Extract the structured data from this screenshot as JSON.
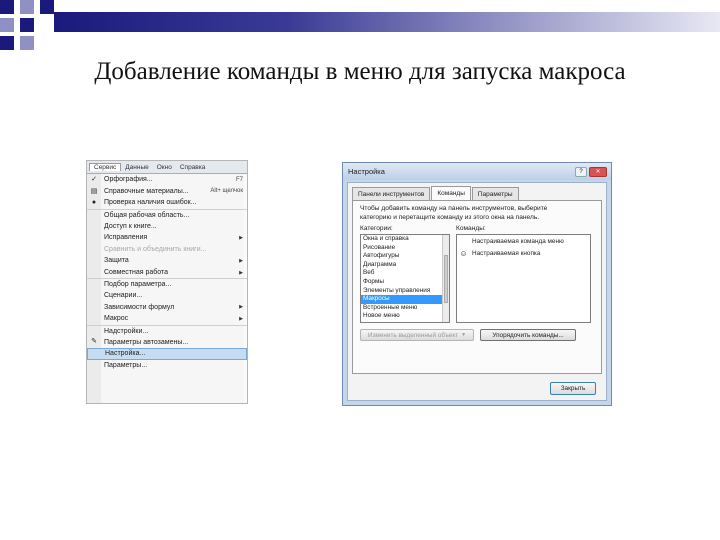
{
  "slide": {
    "title": "Добавление команды в меню для запуска макроса"
  },
  "colors": {
    "header_dark": "#1a1a7c",
    "header_light": "#e8e8f4",
    "highlight": "#c6dcf3",
    "selection": "#3399ff"
  },
  "menu": {
    "menubar": [
      "Сервис",
      "Данные",
      "Окно",
      "Справка"
    ],
    "items": [
      {
        "label": "Орфография...",
        "shortcut": "F7",
        "icon": "spelling-icon",
        "glyph": "✓"
      },
      {
        "label": "Справочные материалы...",
        "shortcut": "Alt+ щелчок",
        "icon": "book-icon",
        "glyph": "▤"
      },
      {
        "label": "Проверка наличия ошибок...",
        "icon": "error-check-icon",
        "glyph": "●"
      },
      {
        "label": "Общая рабочая область..."
      },
      {
        "label": "Доступ к книге..."
      },
      {
        "label": "Исправления",
        "submenu": true
      },
      {
        "label": "Сравнить и объединить книги...",
        "disabled": true
      },
      {
        "label": "Защита",
        "submenu": true
      },
      {
        "label": "Совместная работа",
        "submenu": true
      },
      {
        "label": "Подбор параметра..."
      },
      {
        "label": "Сценарии..."
      },
      {
        "label": "Зависимости формул",
        "submenu": true
      },
      {
        "label": "Макрос",
        "submenu": true
      },
      {
        "label": "Надстройки..."
      },
      {
        "label": "Параметры автозамены...",
        "icon": "autocorrect-icon",
        "glyph": "✎"
      },
      {
        "label": "Настройка...",
        "highlighted": true
      },
      {
        "label": "Параметры..."
      }
    ]
  },
  "dialog": {
    "title": "Настройка",
    "title_buttons": [
      "?",
      "✕"
    ],
    "tabs": [
      "Панели инструментов",
      "Команды",
      "Параметры"
    ],
    "active_tab": 1,
    "instruction": "Чтобы добавить команду на панель инструментов, выберите категорию и перетащите команду из этого окна на панель.",
    "categories_label": "Категории:",
    "commands_label": "Команды:",
    "categories": [
      "Окна и справка",
      "Рисование",
      "Автофигуры",
      "Диаграмма",
      "Веб",
      "Формы",
      "Элементы управления",
      "Макросы",
      "Встроенные меню",
      "Новое меню"
    ],
    "selected_category": 7,
    "commands": [
      {
        "label": "Настраиваемая команда меню",
        "icon": "custom-menu-command-icon",
        "glyph": "",
        "selected": true
      },
      {
        "label": "Настраиваемая кнопка",
        "icon": "smiley-icon",
        "glyph": "☺"
      }
    ],
    "modify_selection_label": "Изменить выделенный объект",
    "rearrange_commands_label": "Упорядочить команды...",
    "close_label": "Закрыть"
  }
}
